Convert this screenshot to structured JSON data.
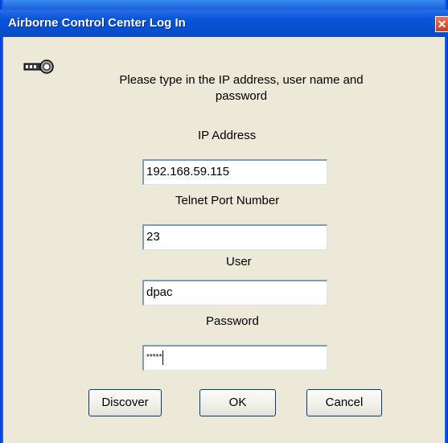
{
  "window": {
    "title": "Airborne Control Center Log In",
    "close_glyph": "✕"
  },
  "instructions": {
    "text": "Please type in the IP address, user name and password"
  },
  "icon": {
    "name": "key-icon"
  },
  "fields": {
    "ip": {
      "label": "IP Address",
      "value": "192.168.59.115"
    },
    "port": {
      "label": "Telnet Port Number",
      "value": "23"
    },
    "user": {
      "label": "User",
      "value": "dpac"
    },
    "password": {
      "label": "Password",
      "masked_value": "*****"
    }
  },
  "buttons": {
    "discover": "Discover",
    "ok": "OK",
    "cancel": "Cancel"
  },
  "colors": {
    "titlebar": "#0a54d8",
    "dialog_bg": "#ece9d8",
    "close_button": "#c8401f"
  }
}
